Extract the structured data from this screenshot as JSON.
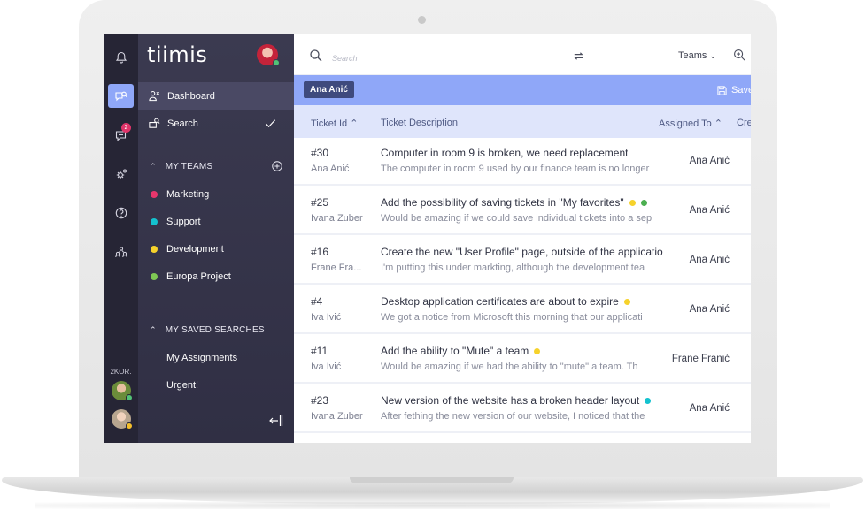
{
  "app": {
    "logo": "tiimis"
  },
  "rail": {
    "badge_count": "2",
    "group_label": "2KOR."
  },
  "sidebar": {
    "nav": [
      {
        "label": "Dashboard",
        "icon": "dashboard-icon"
      },
      {
        "label": "Search",
        "icon": "search-icon",
        "active": true
      }
    ],
    "teams_header": "MY TEAMS",
    "teams": [
      {
        "label": "Marketing",
        "color": "#e8366c"
      },
      {
        "label": "Support",
        "color": "#14c2cf"
      },
      {
        "label": "Development",
        "color": "#f6d22b"
      },
      {
        "label": "Europa Project",
        "color": "#7ec854"
      }
    ],
    "saved_header": "MY SAVED SEARCHES",
    "saved": [
      {
        "label": "My Assignments"
      },
      {
        "label": "Urgent!"
      }
    ]
  },
  "topbar": {
    "search_placeholder": "Search",
    "teams_label": "Teams"
  },
  "filterbar": {
    "chip": "Ana Anić",
    "save_label": "Save"
  },
  "table": {
    "headers": {
      "ticket_id": "Ticket Id",
      "description": "Ticket Description",
      "assigned": "Assigned To",
      "created": "Cre"
    },
    "rows": [
      {
        "id": "#30",
        "author": "Ana Anić",
        "title": "Computer in room 9 is broken, we need replacement",
        "desc": "The computer in room 9 used by our finance team is no longer",
        "assigned": "Ana Anić",
        "tags": []
      },
      {
        "id": "#25",
        "author": "Ivana Zuber",
        "title": "Add the possibility of saving tickets in \"My favorites\"",
        "desc": "Would be amazing if we could save individual tickets into a sep",
        "assigned": "Ana Anić",
        "tags": [
          "#f6d22b",
          "#4caf50"
        ]
      },
      {
        "id": "#16",
        "author": "Frane Fra...",
        "title": "Create the new \"User Profile\" page, outside of the applicatio",
        "desc": "I'm putting this under markting, although the development tea",
        "assigned": "Ana Anić",
        "tags": []
      },
      {
        "id": "#4",
        "author": "Iva Ivić",
        "title": "Desktop application certificates are about to expire",
        "desc": "We got a notice from Microsoft this morning that our applicati",
        "assigned": "Ana Anić",
        "tags": [
          "#f6d22b"
        ]
      },
      {
        "id": "#11",
        "author": "Iva Ivić",
        "title": "Add the ability to \"Mute\" a team",
        "desc": "Would be amazing if we had the ability to \"mute\" a team. Th",
        "assigned": "Frane Franić",
        "tags": [
          "#f6d22b"
        ]
      },
      {
        "id": "#23",
        "author": "Ivana Zuber",
        "title": "New version of the website has a broken header layout",
        "desc": "After fething the new version of our website, I noticed that the",
        "assigned": "Ana Anić",
        "tags": [
          "#14c2cf"
        ]
      }
    ]
  }
}
